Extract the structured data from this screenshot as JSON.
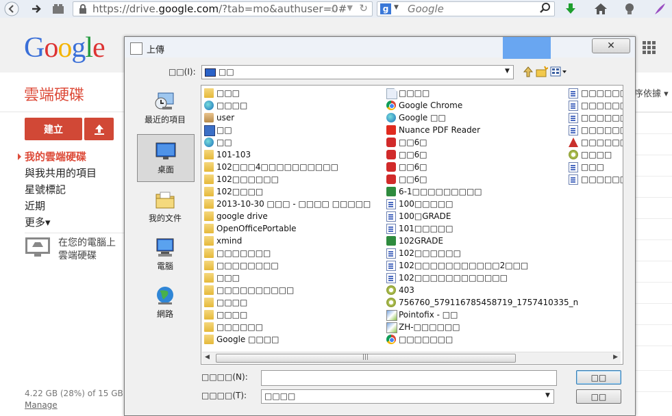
{
  "browser": {
    "url_prefix": "https://drive.",
    "url_domain": "google.com",
    "url_suffix": "/?tab=mo&authuser=0#",
    "search_placeholder": "Google",
    "search_engine_letter": "g"
  },
  "drive": {
    "logo_letters": [
      "G",
      "o",
      "o",
      "g",
      "l",
      "e"
    ],
    "title": "雲端硬碟",
    "create_label": "建立",
    "nav": [
      "我的雲端硬碟",
      "與我共用的項目",
      "星號標記",
      "近期",
      "更多▾"
    ],
    "promo_text": "在您的電腦上 雲端硬碟",
    "storage_text": "4.22 GB (28%) of 15 GB",
    "manage_label": "Manage",
    "sort_label": "序依據 ▾"
  },
  "dialog": {
    "title": "上傳",
    "close_glyph": "✕",
    "lookin_label": "□□(I):",
    "lookin_value": "□□",
    "places": [
      "最近的項目",
      "桌面",
      "我的文件",
      "電腦",
      "網路"
    ],
    "columns": [
      [
        {
          "icon": "folder",
          "name": "□□□"
        },
        {
          "icon": "globe",
          "name": "□□□□"
        },
        {
          "icon": "user",
          "name": "user"
        },
        {
          "icon": "pc",
          "name": "□□"
        },
        {
          "icon": "globe",
          "name": "□□"
        },
        {
          "icon": "folder",
          "name": "101-103"
        },
        {
          "icon": "folder",
          "name": "102□□□4□□□□□□□□□□"
        },
        {
          "icon": "folder",
          "name": "102□□□□□□"
        },
        {
          "icon": "folder",
          "name": "102□□□□"
        },
        {
          "icon": "folder",
          "name": "2013-10-30 □□□ - □□□□ □□□□□"
        },
        {
          "icon": "folder",
          "name": "google drive"
        },
        {
          "icon": "folder",
          "name": "OpenOfficePortable"
        },
        {
          "icon": "folder",
          "name": "xmind"
        },
        {
          "icon": "folder",
          "name": "□□□□□□□"
        },
        {
          "icon": "folder",
          "name": "□□□□□□□□"
        },
        {
          "icon": "folder",
          "name": "□□□"
        },
        {
          "icon": "folder",
          "name": "□□□□□□□□□□"
        },
        {
          "icon": "folder",
          "name": "□□□□"
        },
        {
          "icon": "folder",
          "name": "□□□□"
        },
        {
          "icon": "folder",
          "name": "□□□□□□"
        },
        {
          "icon": "folder",
          "name": "Google □□□□"
        }
      ],
      [
        {
          "icon": "blank",
          "name": "□□□□"
        },
        {
          "icon": "chrome",
          "name": "Google Chrome"
        },
        {
          "icon": "globe",
          "name": "Google □□"
        },
        {
          "icon": "pdf",
          "name": "Nuance PDF Reader"
        },
        {
          "icon": "red",
          "name": "□□6□"
        },
        {
          "icon": "red",
          "name": "□□6□"
        },
        {
          "icon": "red",
          "name": "□□6□"
        },
        {
          "icon": "red",
          "name": "□□6□"
        },
        {
          "icon": "green",
          "name": "6-1□□□□□□□□□"
        },
        {
          "icon": "doc",
          "name": "100□□□□□"
        },
        {
          "icon": "doc",
          "name": "100□GRADE"
        },
        {
          "icon": "doc",
          "name": "101□□□□□"
        },
        {
          "icon": "green",
          "name": "102GRADE"
        },
        {
          "icon": "doc",
          "name": "102□□□□□□"
        },
        {
          "icon": "doc",
          "name": "102□□□□□□□□□□□2□□□"
        },
        {
          "icon": "doc",
          "name": "102□□□□□□□□□□□□"
        },
        {
          "icon": "gear",
          "name": "403"
        },
        {
          "icon": "gear",
          "name": "756760_579116785458719_1757410335_n"
        },
        {
          "icon": "img",
          "name": "Pointofix - □□"
        },
        {
          "icon": "img",
          "name": "ZH-□□□□□□"
        },
        {
          "icon": "chrome",
          "name": "□□□□□□□"
        }
      ],
      [
        {
          "icon": "doc",
          "name": "□□□□□□□"
        },
        {
          "icon": "doc",
          "name": "□□□□□□"
        },
        {
          "icon": "doc",
          "name": "□□□□□□"
        },
        {
          "icon": "doc",
          "name": "□□□□□□"
        },
        {
          "icon": "acro",
          "name": "□□□□□□"
        },
        {
          "icon": "gear",
          "name": "□□□□"
        },
        {
          "icon": "doc",
          "name": "□□□"
        },
        {
          "icon": "doc",
          "name": "□□□□□□"
        }
      ]
    ],
    "filename_label": "□□□□(N):",
    "filename_value": "",
    "filetype_label": "□□□□(T):",
    "filetype_value": "□□□□",
    "open_button": "□□",
    "cancel_button": "□□"
  }
}
